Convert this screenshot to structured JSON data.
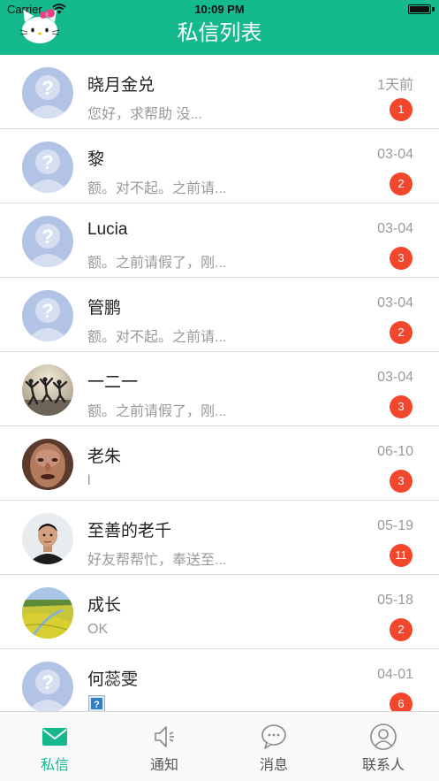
{
  "status_bar": {
    "carrier": "Carrier",
    "time": "10:09 PM"
  },
  "header": {
    "title": "私信列表"
  },
  "conversations": [
    {
      "name": "晓月金兑",
      "preview": "您好，求帮助 没...",
      "date": "1天前",
      "unread": "1",
      "avatar": "placeholder-avatar"
    },
    {
      "name": "黎",
      "preview": "额。对不起。之前请...",
      "date": "03-04",
      "unread": "2",
      "avatar": "placeholder-avatar"
    },
    {
      "name": "Lucia",
      "preview": "额。之前请假了，刚...",
      "date": "03-04",
      "unread": "3",
      "avatar": "placeholder-avatar"
    },
    {
      "name": "管鹏",
      "preview": "额。对不起。之前请...",
      "date": "03-04",
      "unread": "2",
      "avatar": "placeholder-avatar"
    },
    {
      "name": "一二一",
      "preview": "额。之前请假了，刚...",
      "date": "03-04",
      "unread": "3",
      "avatar": "jumping-people-photo"
    },
    {
      "name": "老朱",
      "preview": "l",
      "date": "06-10",
      "unread": "3",
      "avatar": "face-closeup-photo"
    },
    {
      "name": "至善的老千",
      "preview": "好友帮帮忙，奉送至...",
      "date": "05-19",
      "unread": "11",
      "avatar": "man-portrait-photo"
    },
    {
      "name": "成长",
      "preview": "OK",
      "date": "05-18",
      "unread": "2",
      "avatar": "rapeseed-field-photo"
    },
    {
      "name": "何蕊雯",
      "preview": "",
      "date": "04-01",
      "unread": "6",
      "avatar": "placeholder-avatar",
      "preview_icon": "broken-image-icon"
    }
  ],
  "tabs": [
    {
      "label": "私信",
      "icon": "mail-icon",
      "active": true
    },
    {
      "label": "通知",
      "icon": "speaker-icon",
      "active": false
    },
    {
      "label": "消息",
      "icon": "chat-bubble-icon",
      "active": false
    },
    {
      "label": "联系人",
      "icon": "contact-icon",
      "active": false
    }
  ],
  "colors": {
    "accent": "#14b98d",
    "badge": "#f2472d",
    "placeholder_avatar": "#b3c3e6"
  }
}
